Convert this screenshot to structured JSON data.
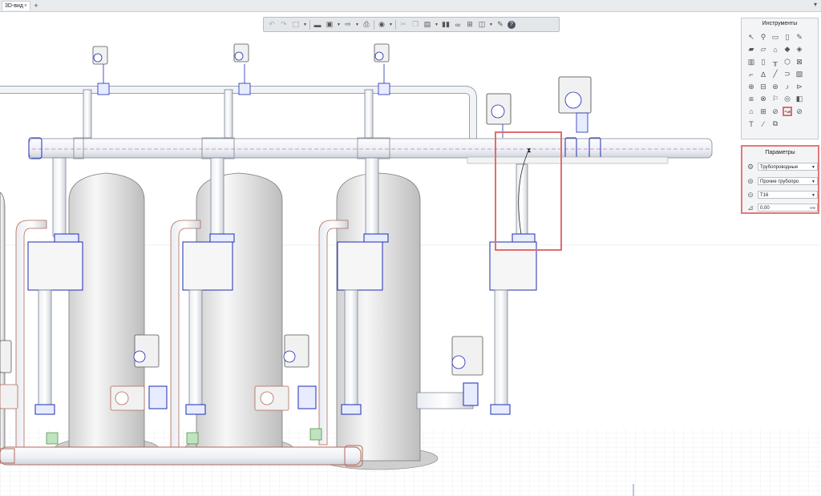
{
  "tabs": [
    {
      "label": "3D-вид",
      "close": "×"
    }
  ],
  "add_tab": "+",
  "window_chevron": "▾",
  "toolbar": {
    "icons": [
      "undo-icon",
      "redo-icon",
      "select-tool-icon",
      "model-icon",
      "save-icon",
      "export-icon",
      "print-icon",
      "view-3d-icon",
      "cut-icon",
      "copy-icon",
      "paste-icon",
      "columns-icon",
      "link-icon",
      "tree-icon",
      "layers-icon",
      "wrench-icon",
      "help-icon"
    ]
  },
  "tools_panel": {
    "title": "Инструменты",
    "tools": [
      "pointer",
      "orbit",
      "rectangle",
      "door",
      "pen",
      "wall",
      "slab",
      "roof",
      "shell",
      "stairs",
      "window",
      "sink",
      "beam",
      "panel",
      "lamp",
      "column",
      "pipe",
      "railing",
      "duct",
      "fan",
      "ceiling",
      "curtain",
      "mesh",
      "pipe-fitting",
      "box",
      "cube",
      "stamp",
      "camera",
      "arch",
      "cabinet",
      "boiler",
      "pipe-route",
      "dimension",
      "text",
      "brush",
      "mirror"
    ],
    "selected_tool": "pipe-route"
  },
  "params_panel": {
    "title": "Параметры",
    "system_value": "Трубопроводные",
    "type_value": "Прочие трубопро",
    "size_value": "Т16",
    "offset_value": "0,00",
    "offset_unit": "мм"
  }
}
